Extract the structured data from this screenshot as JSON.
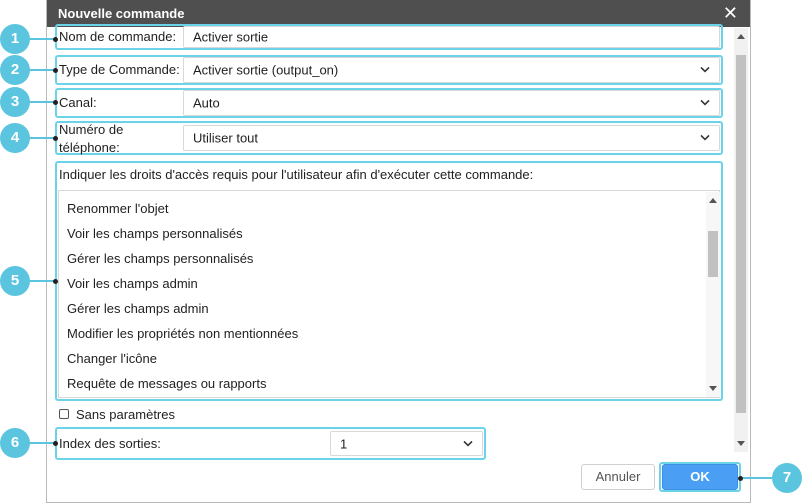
{
  "dialog": {
    "title": "Nouvelle commande"
  },
  "form": {
    "command_name_label": "Nom de commande:",
    "command_name_value": "Activer sortie",
    "command_type_label": "Type de Commande:",
    "command_type_value": "Activer sortie (output_on)",
    "channel_label": "Canal:",
    "channel_value": "Auto",
    "phone_label_line1": "Numéro de",
    "phone_label_line2": "téléphone:",
    "phone_value": "Utiliser tout",
    "rights_label": "Indiquer les droits d'accès requis pour l'utilisateur afin d'exécuter cette commande:",
    "rights_items": [
      "Renommer l'objet",
      "Voir les champs personnalisés",
      "Gérer les champs personnalisés",
      "Voir les champs admin",
      "Gérer les champs admin",
      "Modifier les propriétés non mentionnées",
      "Changer l'icône",
      "Requête de messages ou rapports"
    ],
    "no_params_label": "Sans paramètres",
    "output_index_label": "Index des sorties:",
    "output_index_value": "1"
  },
  "buttons": {
    "cancel": "Annuler",
    "ok": "OK"
  },
  "callouts": [
    "1",
    "2",
    "3",
    "4",
    "5",
    "6",
    "7"
  ],
  "colors": {
    "accent": "#5bc5e0",
    "ok_button": "#4a9ff5",
    "titlebar": "#4f4f4f"
  }
}
